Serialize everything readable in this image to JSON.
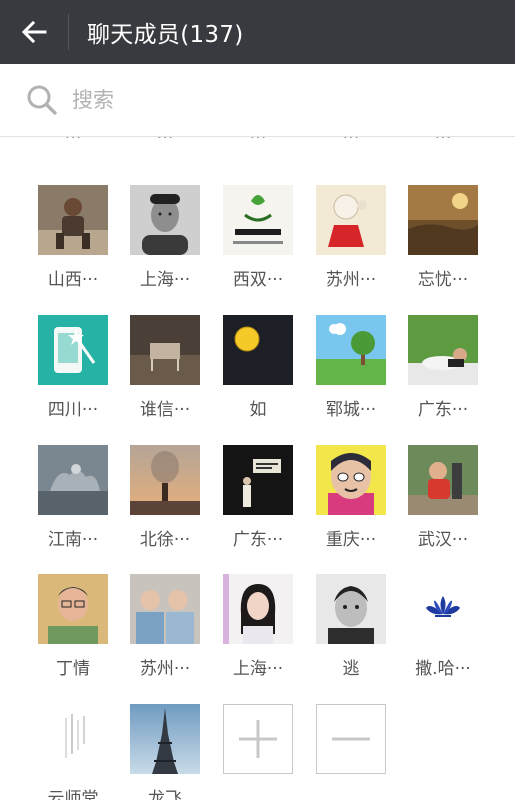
{
  "header": {
    "title": "聊天成员(137)",
    "back_icon": "arrow-left-icon"
  },
  "search": {
    "placeholder": "搜索",
    "value": "",
    "icon": "search-icon"
  },
  "partial_row": [
    {
      "name": "…"
    },
    {
      "name": "…"
    },
    {
      "name": "…"
    },
    {
      "name": "…"
    },
    {
      "name": "…"
    }
  ],
  "members": [
    {
      "name": "山西···"
    },
    {
      "name": "上海···"
    },
    {
      "name": "西双···"
    },
    {
      "name": "苏州···"
    },
    {
      "name": "忘忧···"
    },
    {
      "name": "四川···"
    },
    {
      "name": "谁信···"
    },
    {
      "name": "如"
    },
    {
      "name": "郓城···"
    },
    {
      "name": "广东···"
    },
    {
      "name": "江南···"
    },
    {
      "name": "北徐···"
    },
    {
      "name": "广东···"
    },
    {
      "name": "重庆···"
    },
    {
      "name": "武汉···"
    },
    {
      "name": "丁情"
    },
    {
      "name": "苏州···"
    },
    {
      "name": "上海···"
    },
    {
      "name": "逃"
    },
    {
      "name": "撒.哈···"
    },
    {
      "name": "云师堂"
    },
    {
      "name": "龙飞"
    }
  ],
  "actions": {
    "add_icon": "plus-icon",
    "remove_icon": "minus-icon"
  },
  "colors": {
    "header_bg": "#393a3f",
    "divider": "#e3e3e3"
  }
}
